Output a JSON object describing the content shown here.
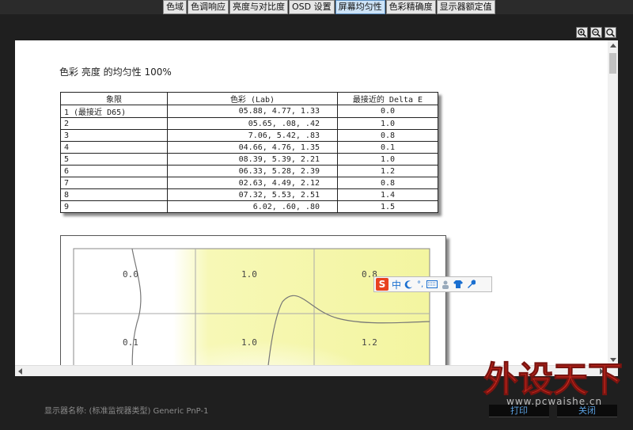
{
  "tabs": [
    {
      "label": "色域",
      "active": false
    },
    {
      "label": "色调响应",
      "active": false
    },
    {
      "label": "亮度与对比度",
      "active": false
    },
    {
      "label": "OSD 设置",
      "active": false
    },
    {
      "label": "屏幕均匀性",
      "active": true
    },
    {
      "label": "色彩精确度",
      "active": false
    },
    {
      "label": "显示器额定值",
      "active": false
    }
  ],
  "toolbar": {
    "zoom_in_icon": "zoom-in-icon",
    "zoom_out_icon": "zoom-out-icon",
    "zoom_fit_icon": "zoom-fit-icon"
  },
  "report": {
    "title": "色彩 亮度 的均匀性 100%",
    "table": {
      "headers": [
        "象限",
        "色彩 (Lab)",
        "最接近的 Delta E"
      ],
      "rows": [
        {
          "quadrant": "1 (最接近 D65)",
          "lab": "05.88,   4.77,    1.33",
          "delta_e": "0.0"
        },
        {
          "quadrant": "2",
          "lab": "05.65,    .08,     .42",
          "delta_e": "1.0"
        },
        {
          "quadrant": "3",
          "lab": "7.06,   5.42,     .83",
          "delta_e": "0.8"
        },
        {
          "quadrant": "4",
          "lab": "04.66,   4.76,    1.35",
          "delta_e": "0.1"
        },
        {
          "quadrant": "5",
          "lab": "08.39,   5.39,    2.21",
          "delta_e": "1.0"
        },
        {
          "quadrant": "6",
          "lab": "06.33,   5.28,    2.39",
          "delta_e": "1.2"
        },
        {
          "quadrant": "7",
          "lab": "02.63,   4.49,    2.12",
          "delta_e": "0.8"
        },
        {
          "quadrant": "8",
          "lab": "07.32,   5.53,    2.51",
          "delta_e": "1.4"
        },
        {
          "quadrant": "9",
          "lab": "6.02,    .60,     .80",
          "delta_e": "1.5"
        }
      ]
    },
    "uniformity_map": {
      "visible_values": [
        "0.0",
        "1.0",
        "0.8",
        "0.1",
        "1.0",
        "1.2"
      ],
      "highlight_color": "#f3f5a0"
    }
  },
  "ime_toolbar": {
    "logo": "S",
    "mode": "中",
    "items": [
      "moon-icon",
      "punctuation-icon",
      "keyboard-icon",
      "user-icon",
      "shirt-icon",
      "wrench-icon"
    ]
  },
  "footer": {
    "monitor_label": "显示器名称: (标准监视器类型) Generic PnP-1",
    "print_label": "打印",
    "close_label": "关闭"
  },
  "watermark": {
    "text": "外设天下",
    "url": "www.pcwaishe.cn"
  }
}
